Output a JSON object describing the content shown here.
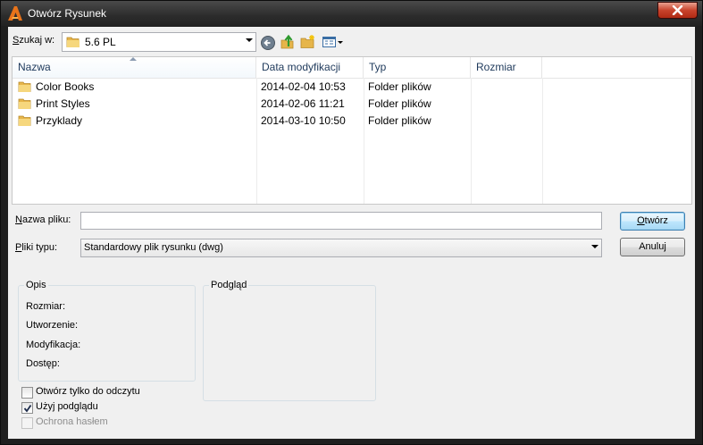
{
  "window": {
    "title": "Otwórz Rysunek",
    "icon": "autocad-a-icon",
    "accent_color": "#e8731a"
  },
  "lookin": {
    "label_prefix": "",
    "label_hotkey": "S",
    "label_rest": "zukaj w:",
    "value": "5.6 PL",
    "toolbar_icons": [
      "back-icon",
      "up-folder-icon",
      "new-folder-icon",
      "view-menu-icon"
    ]
  },
  "file_list": {
    "columns": [
      "Nazwa",
      "Data modyfikacji",
      "Typ",
      "Rozmiar"
    ],
    "rows": [
      {
        "name": "Color Books",
        "date": "2014-02-04 10:53",
        "type": "Folder plików",
        "size": ""
      },
      {
        "name": "Print Styles",
        "date": "2014-02-06 11:21",
        "type": "Folder plików",
        "size": ""
      },
      {
        "name": "Przyklady",
        "date": "2014-03-10 10:50",
        "type": "Folder plików",
        "size": ""
      }
    ]
  },
  "filename": {
    "label_hotkey": "N",
    "label_rest": "azwa pliku:",
    "value": ""
  },
  "filetype": {
    "label_hotkey": "P",
    "label_rest": "liki typu:",
    "value": "Standardowy plik rysunku (dwg)"
  },
  "buttons": {
    "open_hotkey": "O",
    "open_rest": "twórz",
    "cancel": "Anuluj"
  },
  "description": {
    "title": "Opis",
    "size_label": "Rozmiar:",
    "created_label": "Utworzenie:",
    "modified_label": "Modyfikacja:",
    "access_label": "Dostęp:"
  },
  "preview": {
    "title": "Podgląd"
  },
  "options": {
    "readonly": {
      "label": "Otwórz tylko do odczytu",
      "checked": false
    },
    "use_preview": {
      "label": "Użyj podglądu",
      "checked": true
    },
    "password": {
      "label": "Ochrona hasłem",
      "checked": false,
      "disabled": true
    }
  }
}
